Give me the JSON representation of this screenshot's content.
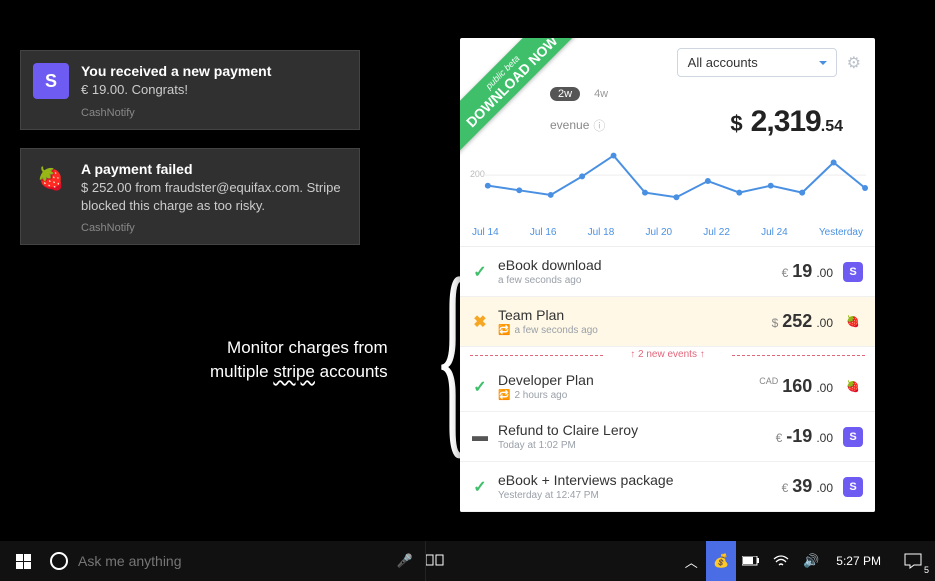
{
  "notifications": [
    {
      "title": "You received a new payment",
      "body": "€ 19.00. Congrats!",
      "source": "CashNotify",
      "icon": "S",
      "iconBg": "#6e5cf2"
    },
    {
      "title": "A payment failed",
      "body": "$ 252.00 from fraudster@equifax.com. Stripe blocked this charge as too risky.",
      "source": "CashNotify",
      "icon": "🍓",
      "iconBg": "transparent"
    }
  ],
  "caption": {
    "line1": "Monitor charges from",
    "line2a": "multiple ",
    "line2b": "stripe",
    "line2c": " accounts"
  },
  "ribbon": {
    "sub": "public beta",
    "main": "DOWNLOAD NOW"
  },
  "panel": {
    "accountSelector": "All accounts",
    "ranges": [
      "2w",
      "4w"
    ],
    "revenueLabel": "evenue",
    "total": {
      "symbol": "$",
      "main": "2,319",
      "cents": ".54"
    },
    "xticks": [
      "Jul 14",
      "Jul 16",
      "Jul 18",
      "Jul 20",
      "Jul 22",
      "Jul 24",
      "Yesterday"
    ],
    "ylabel": "200",
    "dividerText": "↑  2 new events  ↑",
    "transactions": [
      {
        "status": "ok",
        "name": "eBook download",
        "meta": "a few seconds ago",
        "refresh": false,
        "sym": "€",
        "num": "19",
        "cents": ".00",
        "badge": "S",
        "badgeBg": "#6e5cf2"
      },
      {
        "status": "bad",
        "name": "Team Plan",
        "meta": "a few seconds ago",
        "refresh": true,
        "sym": "$",
        "num": "252",
        "cents": ".00",
        "badge": "🍓",
        "badgeBg": "transparent"
      },
      {
        "status": "ok",
        "name": "Developer Plan",
        "meta": "2 hours ago",
        "refresh": true,
        "sym": "CAD",
        "num": "160",
        "cents": ".00",
        "badge": "🍓",
        "badgeBg": "transparent"
      },
      {
        "status": "neu",
        "name": "Refund to Claire Leroy",
        "meta": "Today at 1:02 PM",
        "refresh": false,
        "sym": "€",
        "num": "-19",
        "cents": ".00",
        "badge": "S",
        "badgeBg": "#6e5cf2"
      },
      {
        "status": "ok",
        "name": "eBook + Interviews package",
        "meta": "Yesterday at 12:47 PM",
        "refresh": false,
        "sym": "€",
        "num": "39",
        "cents": ".00",
        "badge": "S",
        "badgeBg": "#6e5cf2"
      }
    ]
  },
  "chart_data": {
    "type": "line",
    "title": "Revenue",
    "ylabel": "",
    "xlabel": "",
    "ylim": [
      0,
      300
    ],
    "categories": [
      "Jul 14",
      "Jul 15",
      "Jul 16",
      "Jul 17",
      "Jul 18",
      "Jul 19",
      "Jul 20",
      "Jul 21",
      "Jul 22",
      "Jul 23",
      "Jul 24",
      "Jul 25",
      "Yesterday"
    ],
    "values": [
      160,
      140,
      120,
      200,
      290,
      130,
      110,
      180,
      130,
      160,
      130,
      260,
      150
    ]
  },
  "taskbar": {
    "searchPlaceholder": "Ask me anything",
    "clock": "5:27 PM",
    "notifCount": "5"
  }
}
